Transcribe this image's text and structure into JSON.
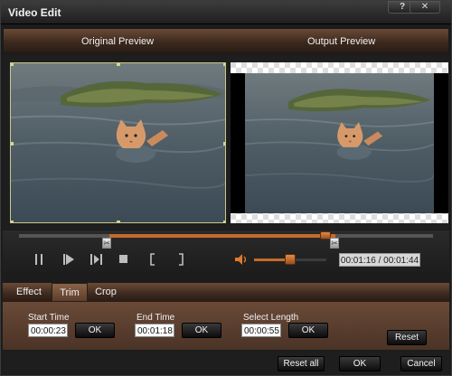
{
  "window": {
    "title": "Video Edit",
    "help_label": "?",
    "close_label": "✕"
  },
  "preview": {
    "original_label": "Original Preview",
    "output_label": "Output Preview"
  },
  "timeline": {
    "start_marker": "✂",
    "end_marker": "✂",
    "position": 0.74
  },
  "playback": {
    "time_display": "00:01:16 / 00:01:44",
    "volume_level": 0.5,
    "icons": [
      "pause-icon",
      "play-icon",
      "next-frame-icon",
      "stop-icon",
      "left-bracket-icon",
      "right-bracket-icon",
      "volume-icon"
    ]
  },
  "tabs": [
    {
      "label": "Effect"
    },
    {
      "label": "Trim",
      "active": true
    },
    {
      "label": "Crop"
    }
  ],
  "trim": {
    "start_label": "Start Time",
    "start_value": "00:00:23",
    "end_label": "End Time",
    "end_value": "00:01:18",
    "length_label": "Select Length",
    "length_value": "00:00:55",
    "ok_label": "OK",
    "reset_label": "Reset"
  },
  "footer": {
    "reset_all_label": "Reset all",
    "ok_label": "OK",
    "cancel_label": "Cancel"
  },
  "colors": {
    "accent": "#c46b2b",
    "panel_brown": "#6a4a37",
    "background": "#1c1c1c"
  }
}
